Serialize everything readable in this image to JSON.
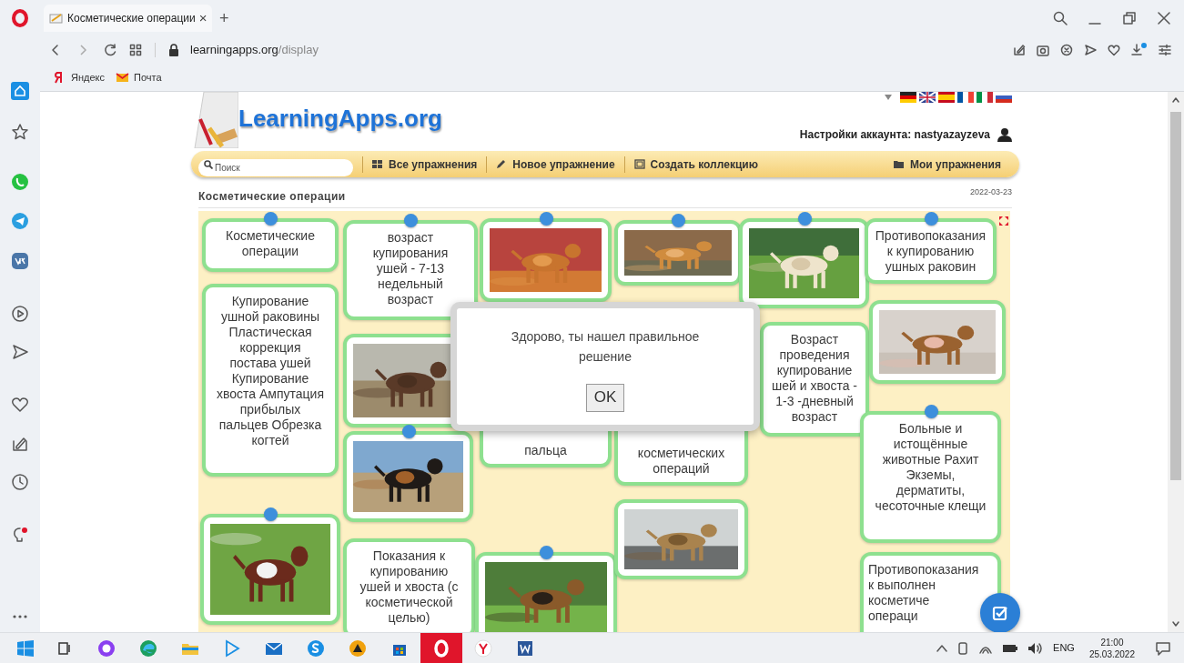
{
  "browser": {
    "tab": {
      "title": "Косметические операции",
      "close": "×"
    },
    "new_tab": "+",
    "address": {
      "host": "learningapps.org",
      "path": "/display"
    },
    "bookmarks": [
      {
        "label": "Яндекс"
      },
      {
        "label": "Почта"
      }
    ]
  },
  "site": {
    "logo": "LearningApps.org",
    "account": "Настройки аккаунта: nastyazayzeva",
    "search": {
      "placeholder": "Поиск"
    },
    "nav": [
      {
        "label": "Все упражнения"
      },
      {
        "label": "Новое упражнение"
      },
      {
        "label": "Создать коллекцию"
      },
      {
        "label": "Мои упражнения"
      }
    ],
    "title": "Косметические операции",
    "date": "2022-03-23"
  },
  "board": {
    "cards": [
      {
        "kind": "text",
        "text": "Косметические операции",
        "pinned": true
      },
      {
        "kind": "text",
        "text": "Купирование ушной раковины Пластическая коррекция постава ушей Купирование хвоста Ампутация прибылых пальцев Обрезка когтей",
        "pinned": false
      },
      {
        "kind": "picture",
        "pinned": true
      },
      {
        "kind": "text",
        "text": "возраст купирования ушей - 7-13 недельный возраст",
        "pinned": true
      },
      {
        "kind": "picture",
        "pinned": false
      },
      {
        "kind": "picture",
        "pinned": true
      },
      {
        "kind": "text",
        "text": "Показания к купированию ушей и хвоста (с косметической целью)",
        "pinned": false
      },
      {
        "kind": "picture",
        "pinned": true
      },
      {
        "kind": "text",
        "text": "пальца",
        "pinned": false
      },
      {
        "kind": "picture",
        "pinned": true
      },
      {
        "kind": "picture",
        "pinned": true
      },
      {
        "kind": "text",
        "text": "косметических операций",
        "pinned": false
      },
      {
        "kind": "picture",
        "pinned": false
      },
      {
        "kind": "picture",
        "pinned": true
      },
      {
        "kind": "text",
        "text": "Возраст\nпроведения\nкупирование\nшей и хвоста -\n1-3 -дневный\nвозраст",
        "pinned": false
      },
      {
        "kind": "text",
        "text": "Противопоказания к купированию ушных раковин",
        "pinned": true
      },
      {
        "kind": "picture",
        "pinned": false
      },
      {
        "kind": "text",
        "text": "Больные и истощённые животные Рахит Экземы, дерматиты, чесоточные клещи",
        "pinned": true
      },
      {
        "kind": "text",
        "text": "Противопоказания\nк выполнен\nкосметиче\nопераци",
        "pinned": false
      }
    ]
  },
  "dialog": {
    "message": "Здорово, ты нашел правильное решение",
    "button": "OK"
  },
  "taskbar": {
    "apps": [
      {
        "selected": false
      },
      {
        "selected": false
      },
      {
        "selected": false
      },
      {
        "selected": false
      },
      {
        "selected": false
      },
      {
        "selected": false
      },
      {
        "selected": false
      },
      {
        "selected": false
      },
      {
        "selected": false
      },
      {
        "selected": true
      },
      {
        "selected": false
      },
      {
        "selected": false
      }
    ],
    "language": "ENG",
    "time": "21:00",
    "date": "25.03.2022"
  }
}
